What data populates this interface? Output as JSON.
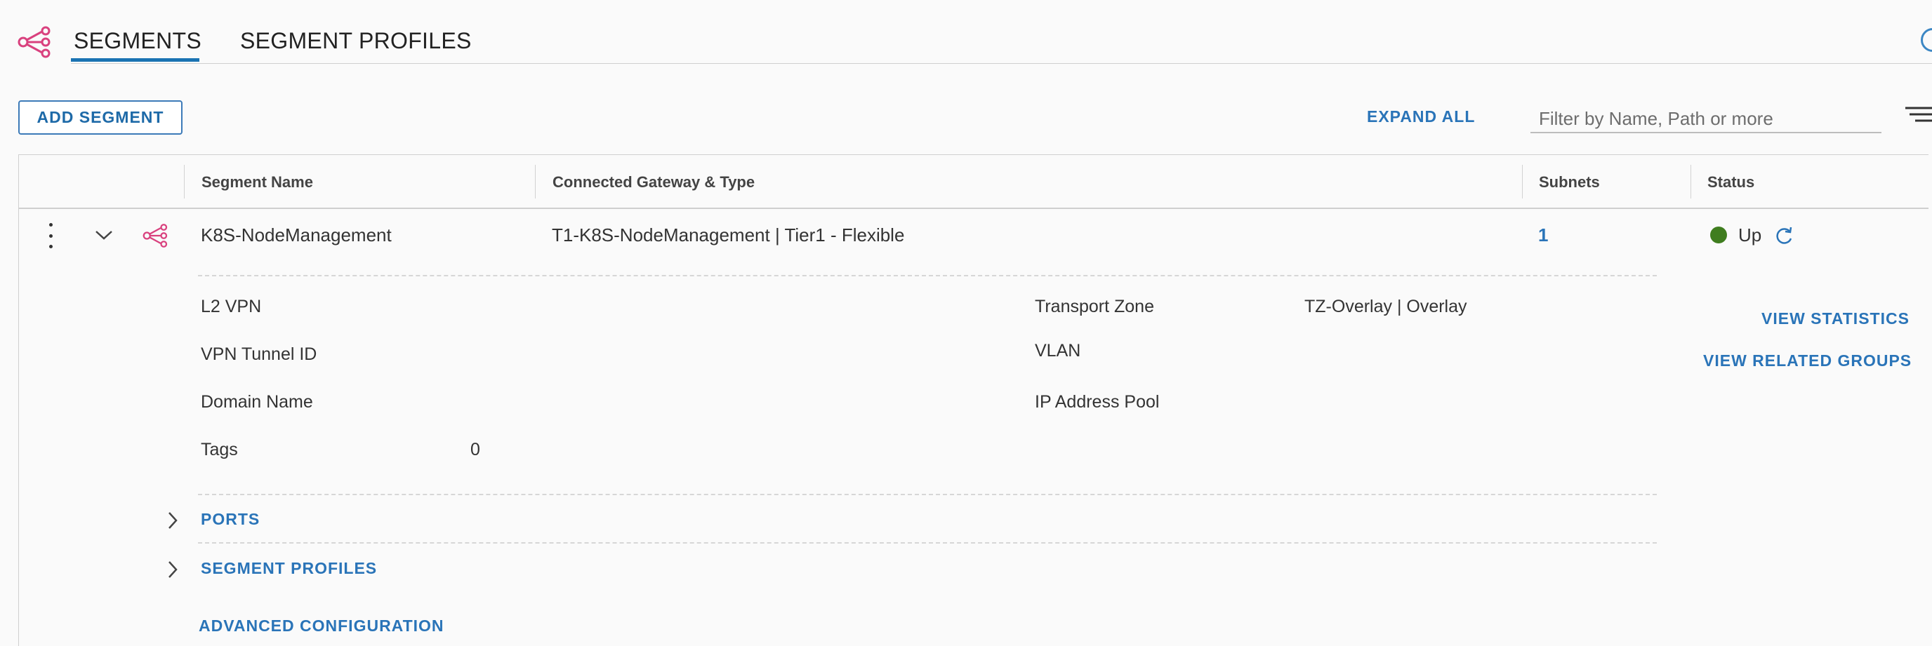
{
  "tabs": [
    {
      "label": "SEGMENTS",
      "active": true
    },
    {
      "label": "SEGMENT PROFILES",
      "active": false
    }
  ],
  "toolbar": {
    "add_segment_label": "ADD SEGMENT",
    "expand_all_label": "EXPAND ALL",
    "filter_placeholder": "Filter by Name, Path or more"
  },
  "table": {
    "columns": [
      "Segment Name",
      "Connected Gateway & Type",
      "Subnets",
      "Status"
    ],
    "row": {
      "segment_name": "K8S-NodeManagement",
      "connected_gateway": "T1-K8S-NodeManagement | Tier1 - Flexible",
      "subnets": "1",
      "status": "Up",
      "status_color": "#3f7d1f"
    }
  },
  "details": {
    "l2_vpn_label": "L2 VPN",
    "vpn_tunnel_id_label": "VPN Tunnel ID",
    "domain_name_label": "Domain Name",
    "tags_label": "Tags",
    "tags_value": "0",
    "transport_zone_label": "Transport Zone",
    "transport_zone_value": "TZ-Overlay | Overlay",
    "vlan_label": "VLAN",
    "ip_address_pool_label": "IP Address Pool",
    "view_statistics_label": "VIEW STATISTICS",
    "view_related_groups_label": "VIEW RELATED GROUPS",
    "ports_label": "PORTS",
    "segment_profiles_label": "SEGMENT PROFILES",
    "advanced_configuration_label": "ADVANCED CONFIGURATION"
  },
  "colors": {
    "accent": "#2a74b8",
    "segment_icon": "#d9417e",
    "status_up": "#3f7d1f"
  },
  "icons": [
    "segments-icon",
    "segment-row-icon",
    "refresh-icon",
    "filter-icon",
    "chevron-down-icon",
    "chevron-right-icon",
    "more-vertical-icon",
    "help-icon"
  ]
}
